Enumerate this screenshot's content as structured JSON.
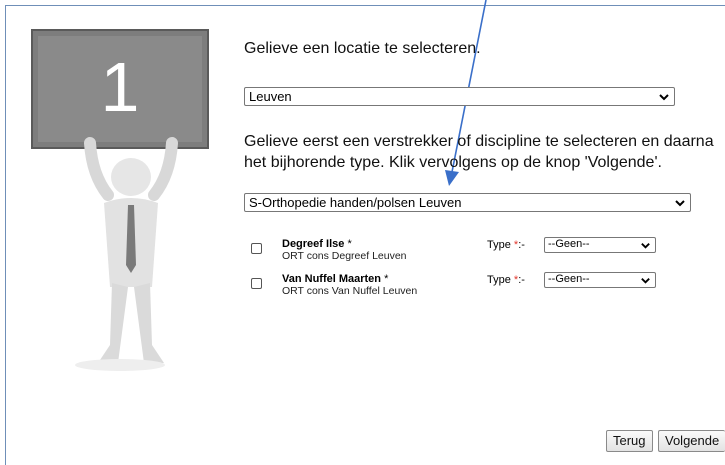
{
  "header": {
    "title": "Gelieve een locatie te selecteren."
  },
  "step": {
    "number": "1"
  },
  "location_select": {
    "value": "Leuven"
  },
  "instructions": "Gelieve eerst een verstrekker of discipline te selecteren en daarna het bijhorende type. Klik vervolgens op de knop 'Volgende'.",
  "discipline_select": {
    "value": "S-Orthopedie handen/polsen Leuven"
  },
  "practitioners": [
    {
      "name": "Degreef Ilse",
      "required": "*",
      "subtitle": "ORT cons Degreef Leuven",
      "type_label": "Type",
      "type_required": "*",
      "type_suffix": ":-",
      "type_value": "--Geen--"
    },
    {
      "name": "Van Nuffel Maarten",
      "required": "*",
      "subtitle": "ORT cons Van Nuffel Leuven",
      "type_label": "Type",
      "type_required": "*",
      "type_suffix": ":-",
      "type_value": "--Geen--"
    }
  ],
  "buttons": {
    "back": "Terug",
    "next": "Volgende"
  },
  "colors": {
    "frame_border": "#6f8fb8",
    "annotation_arrow": "#3a6fc9",
    "required_star": "#e0352b"
  }
}
